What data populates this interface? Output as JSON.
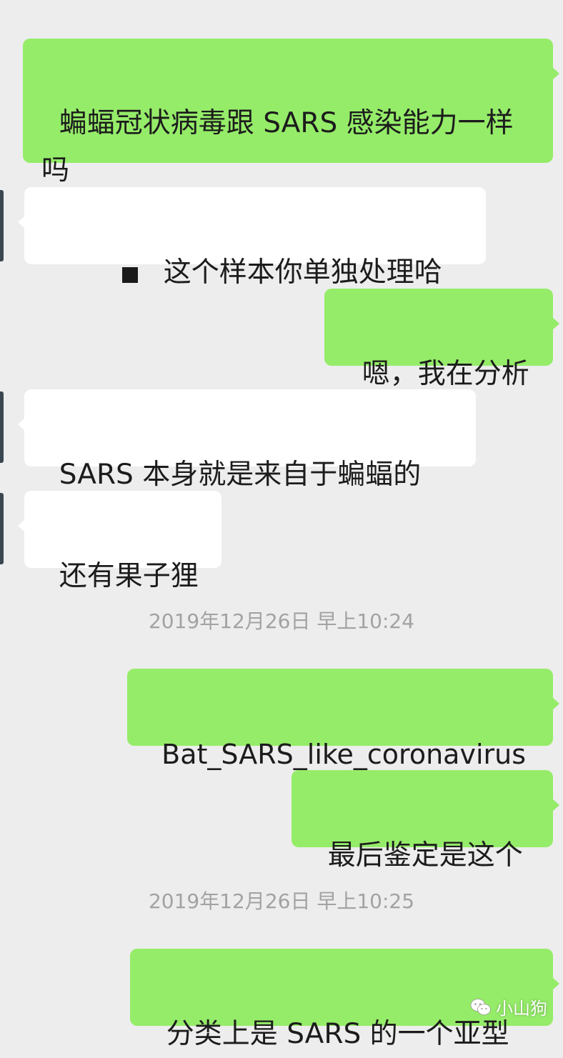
{
  "messages": [
    {
      "direction": "out",
      "text": "蝙蝠冠状病毒跟 SARS 感染能力一样吗"
    },
    {
      "direction": "in",
      "text": "这个样本你单独处理哈"
    },
    {
      "direction": "out",
      "text": "嗯，我在分析"
    },
    {
      "direction": "in",
      "text": "SARS 本身就是来自于蝙蝠的"
    },
    {
      "direction": "in",
      "text": "还有果子狸"
    },
    {
      "direction": "out",
      "text": "Bat_SARS_like_coronavirus"
    },
    {
      "direction": "out",
      "text": "最后鉴定是这个"
    },
    {
      "direction": "out",
      "text": "分类上是 SARS 的一个亚型"
    }
  ],
  "timestamps": [
    "2019年12月26日 早上10:24",
    "2019年12月26日 早上10:25"
  ],
  "watermark": {
    "text": "小山狗",
    "icon": "wechat-icon"
  },
  "colors": {
    "background": "#ededed",
    "outgoing_bubble": "#95ec69",
    "incoming_bubble": "#ffffff",
    "timestamp_text": "#a2a2a2"
  }
}
